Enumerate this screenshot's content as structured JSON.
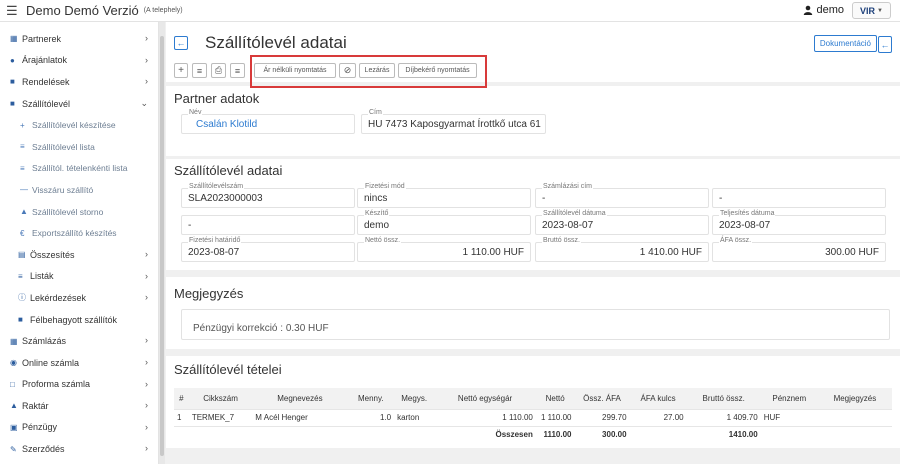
{
  "header": {
    "app_title": "Demo Demó Verzió",
    "app_subtitle": "(A telephely)",
    "user": "demo",
    "logo_text": "VIR"
  },
  "sidebar": {
    "items": [
      {
        "label": "Partnerek",
        "icon": "partners-icon",
        "expandable": true
      },
      {
        "label": "Árajánlatok",
        "icon": "offers-icon",
        "expandable": true
      },
      {
        "label": "Rendelések",
        "icon": "orders-icon",
        "expandable": true
      },
      {
        "label": "Szállítólevél",
        "icon": "delivery-note-icon",
        "expandable": true,
        "expanded": true
      }
    ],
    "subitems": [
      {
        "label": "Szállítólevél készítése",
        "icon": "plus-icon"
      },
      {
        "label": "Szállítólevél lista",
        "icon": "list-icon"
      },
      {
        "label": "Szállítól. tételenkénti lista",
        "icon": "list-detail-icon"
      },
      {
        "label": "Visszáru szállító",
        "icon": "minus-icon"
      },
      {
        "label": "Szállítólevél storno",
        "icon": "storno-icon"
      },
      {
        "label": "Exportszállító készítés",
        "icon": "euro-icon"
      }
    ],
    "items2": [
      {
        "label": "Összesítés",
        "icon": "summary-icon",
        "expandable": true
      },
      {
        "label": "Listák",
        "icon": "lists-icon",
        "expandable": true
      },
      {
        "label": "Lekérdezések",
        "icon": "query-icon",
        "expandable": true
      },
      {
        "label": "Félbehagyott szállítók",
        "icon": "lock-icon",
        "expandable": false
      }
    ],
    "items3": [
      {
        "label": "Számlázás",
        "icon": "invoice-icon",
        "expandable": true
      },
      {
        "label": "Online számla",
        "icon": "globe-icon",
        "expandable": true
      },
      {
        "label": "Proforma számla",
        "icon": "proforma-icon",
        "expandable": true
      },
      {
        "label": "Raktár",
        "icon": "warehouse-icon",
        "expandable": true
      },
      {
        "label": "Pénzügy",
        "icon": "money-icon",
        "expandable": true
      },
      {
        "label": "Szerződés",
        "icon": "contract-icon",
        "expandable": true
      }
    ]
  },
  "page": {
    "title": "Szállítólevél adatai",
    "doc_button": "Dokumentáció"
  },
  "toolbar": {
    "price_free_print": "Ár nélküli nyomtatás",
    "close_label": "Lezárás",
    "fee_request_print": "Díjbekérő nyomtatás"
  },
  "partner": {
    "section_title": "Partner adatok",
    "name_label": "Név",
    "name_value": "Csalán Klotild",
    "address_label": "Cím",
    "address_value": "HU 7473 Kaposgyarmat Írottkő utca 61"
  },
  "delivery": {
    "section_title": "Szállítólevél adatai",
    "fields": [
      {
        "label": "Szállítólevélszám",
        "value": "SLA2023000003"
      },
      {
        "label": "Fizetési mód",
        "value": "nincs"
      },
      {
        "label": "Számlázási cím",
        "value": "-"
      },
      {
        "label": "",
        "value": "-"
      },
      {
        "label": "",
        "value": "-"
      },
      {
        "label": "Készítő",
        "value": "demo"
      },
      {
        "label": "Szállítólevél dátuma",
        "value": "2023-08-07"
      },
      {
        "label": "Teljesítés dátuma",
        "value": "2023-08-07"
      },
      {
        "label": "Fizetési határidő",
        "value": "2023-08-07"
      },
      {
        "label": "Nettó össz.",
        "value": "1 110.00 HUF"
      },
      {
        "label": "Bruttó össz.",
        "value": "1 410.00 HUF"
      },
      {
        "label": "ÁFA össz.",
        "value": "300.00 HUF"
      }
    ]
  },
  "note": {
    "section_title": "Megjegyzés",
    "text": "Pénzügyi korrekció : 0.30 HUF"
  },
  "items": {
    "section_title": "Szállítólevél tételei",
    "columns": [
      "#",
      "Cikkszám",
      "Megnevezés",
      "Menny.",
      "Megys.",
      "Nettó egységár",
      "Nettó",
      "Össz. ÁFA",
      "ÁFA kulcs",
      "Bruttó össz.",
      "Pénznem",
      "Megjegyzés"
    ],
    "rows": [
      [
        "1",
        "TERMEK_7",
        "M Acél Henger",
        "1.0",
        "karton",
        "1 110.00",
        "1 110.00",
        "299.70",
        "27.00",
        "1 409.70",
        "HUF",
        ""
      ]
    ],
    "total": {
      "label": "Összesen",
      "net": "1110.00",
      "vat": "300.00",
      "gross": "1410.00"
    }
  }
}
